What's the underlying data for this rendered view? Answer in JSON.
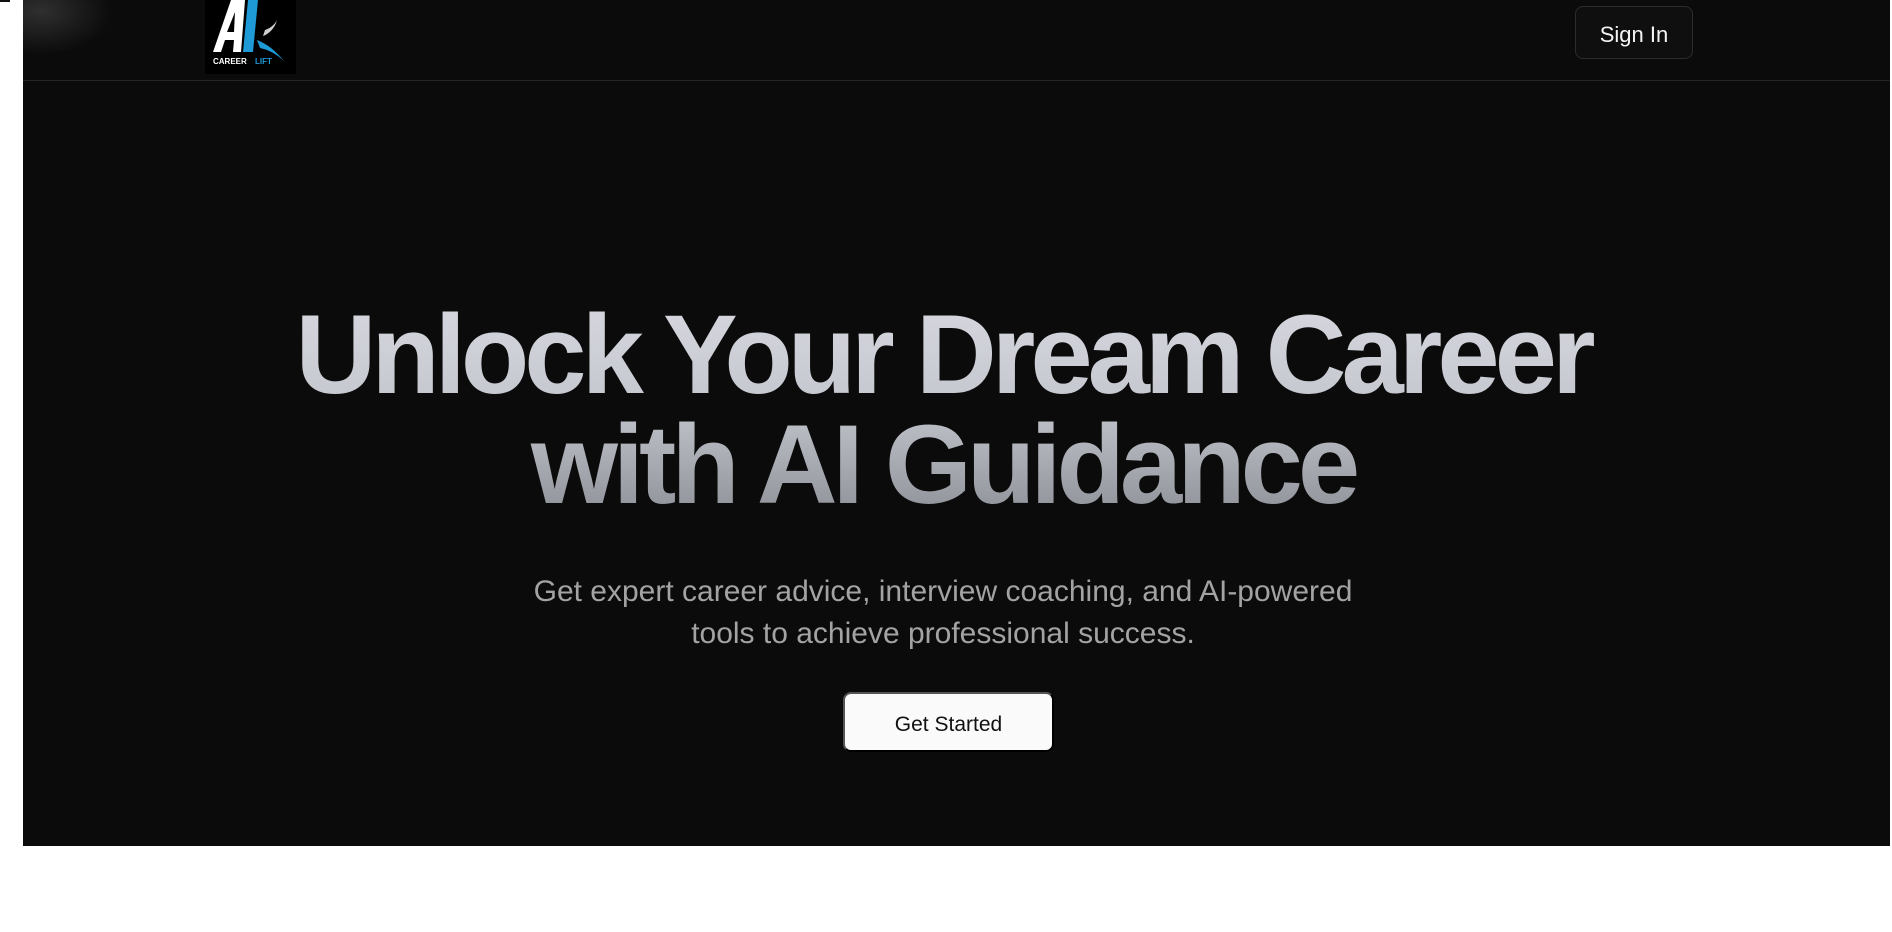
{
  "brand": {
    "logo_word_left": "CAREER",
    "logo_word_right": "LIFT",
    "logo_icon": "ai-career-lift-logo",
    "accent": "#1e9ad6"
  },
  "header": {
    "signin_label": "Sign In"
  },
  "hero": {
    "title_line1": "Unlock Your Dream Career",
    "title_line2": "with AI Guidance",
    "subtitle_line1": "Get expert career advice, interview coaching, and AI-powered",
    "subtitle_line2": "tools to achieve professional success.",
    "cta_label": "Get Started"
  },
  "colors": {
    "background": "#0b0b0b",
    "page": "#ffffff",
    "title_gradient_top": "#d6d7de",
    "title_gradient_bottom": "#8e9098",
    "subtitle": "#a3a3a3",
    "cta_bg": "#fafafa"
  }
}
